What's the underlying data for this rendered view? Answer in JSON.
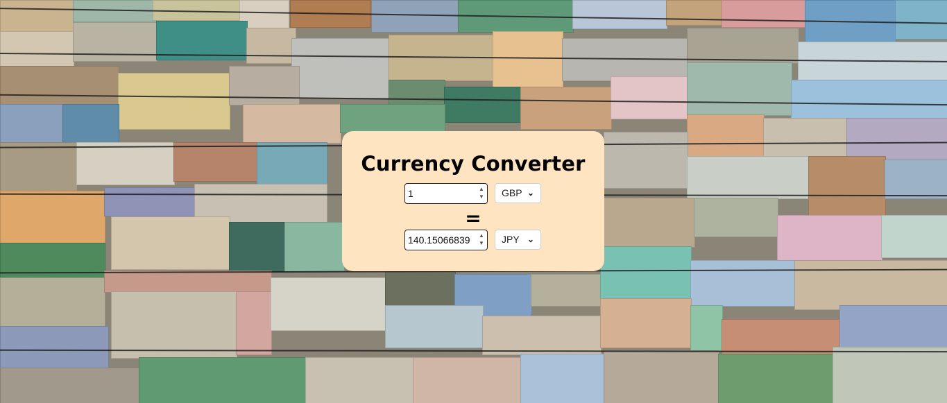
{
  "converter": {
    "title": "Currency Converter",
    "equals_sign": "=",
    "from": {
      "amount": "1",
      "currency": "GBP"
    },
    "to": {
      "amount": "140.15066839",
      "currency": "JPY"
    }
  },
  "colors": {
    "card_background": "#ffe4c2",
    "page_background": "#8b8578"
  },
  "icons": {
    "spinner": "number-spinner-icon",
    "dropdown": "chevron-down-icon"
  }
}
